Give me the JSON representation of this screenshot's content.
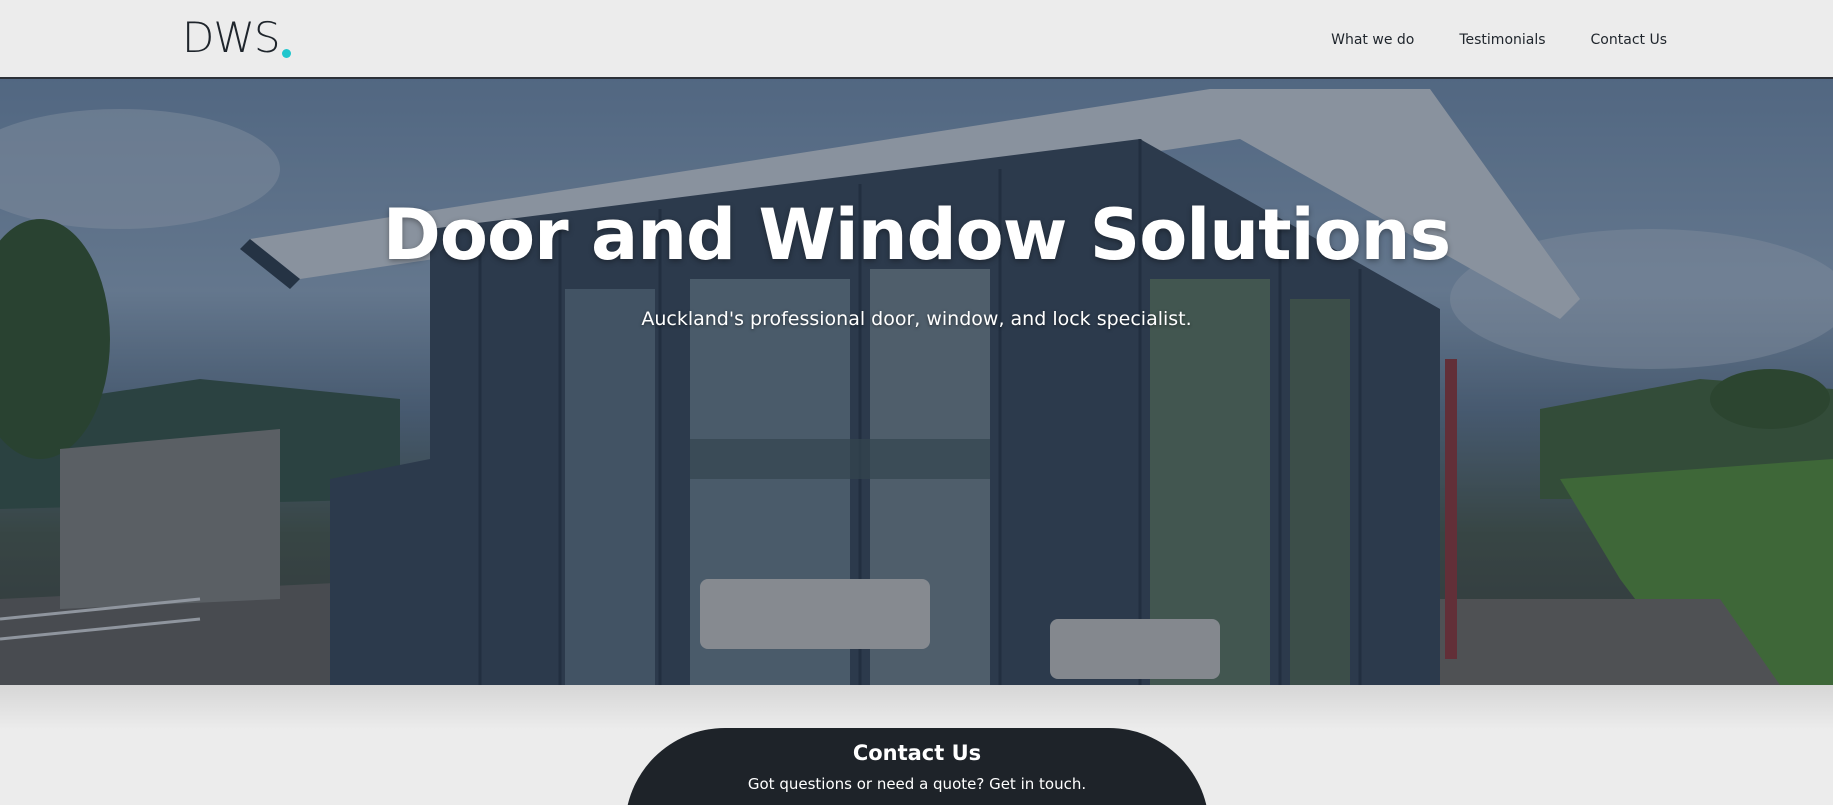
{
  "header": {
    "logo_text": "DWS",
    "nav": [
      {
        "label": "What we do"
      },
      {
        "label": "Testimonials"
      },
      {
        "label": "Contact Us"
      }
    ]
  },
  "hero": {
    "title": "Door and Window Solutions",
    "subtitle": "Auckland's professional door, window, and lock specialist."
  },
  "contact": {
    "title": "Contact Us",
    "subtitle": "Got questions or need a quote? Get in touch."
  },
  "colors": {
    "accent_dot": "#1fc6cd",
    "dark": "#1e2329",
    "background": "#ececec"
  }
}
